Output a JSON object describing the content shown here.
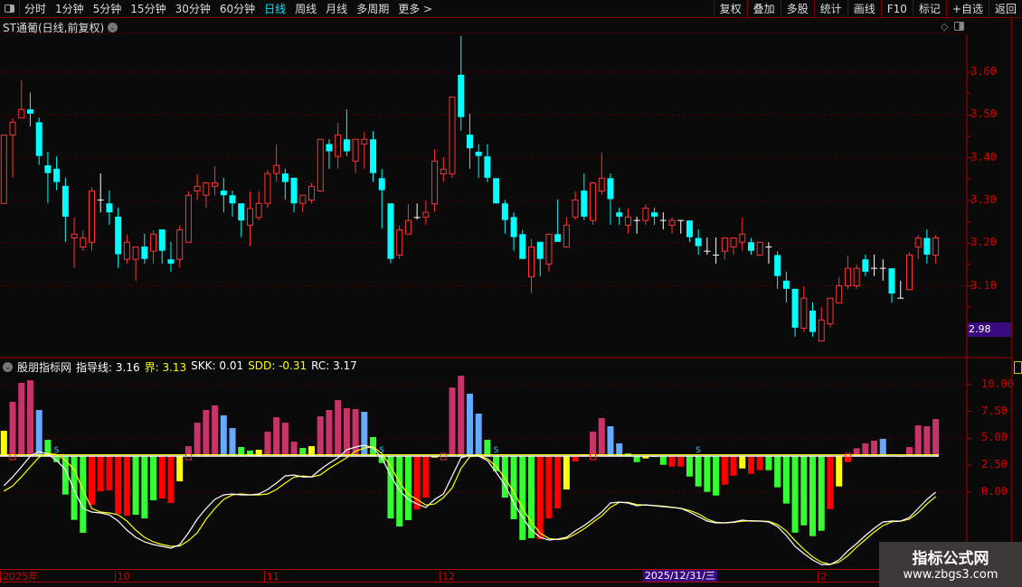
{
  "topbar": {
    "periods": [
      {
        "label": "分时"
      },
      {
        "label": "1分钟"
      },
      {
        "label": "5分钟"
      },
      {
        "label": "15分钟"
      },
      {
        "label": "30分钟"
      },
      {
        "label": "60分钟"
      },
      {
        "label": "日线",
        "active": true
      },
      {
        "label": "周线"
      },
      {
        "label": "月线"
      },
      {
        "label": "多周期"
      },
      {
        "label": "更多 >"
      }
    ],
    "buttons": [
      "复权",
      "叠加",
      "多股",
      "统计",
      "画线",
      "F10",
      "标记",
      "+自选",
      "返回"
    ]
  },
  "stock": {
    "title": "ST通葡(日线,前复权)"
  },
  "price_axis": {
    "ticks": [
      "3.60",
      "3.50",
      "3.40",
      "3.30",
      "3.20",
      "3.10"
    ],
    "tick_values": [
      3.6,
      3.5,
      3.4,
      3.3,
      3.2,
      3.1
    ],
    "current_label": "2.98",
    "current_value": 2.98
  },
  "indicator": {
    "name": "股朋指标网",
    "items": [
      {
        "label": "指导线: 3.16",
        "color": "#ffffff"
      },
      {
        "label": "界: 3.13",
        "color": "#ffff00"
      },
      {
        "label": "SKK: 0.01",
        "color": "#ffffff"
      },
      {
        "label": "SDD: -0.31",
        "color": "#ffff00"
      },
      {
        "label": "RC: 3.17",
        "color": "#ffffff"
      }
    ],
    "ticks": [
      "10.00",
      "7.50",
      "5.00",
      "2.50",
      "0.00"
    ],
    "tick_values": [
      10,
      7.5,
      5,
      2.5,
      0
    ]
  },
  "date_axis": {
    "labels": [
      {
        "text": "2025年",
        "i": 0
      },
      {
        "text": "10",
        "i": 13
      },
      {
        "text": "11",
        "i": 30
      },
      {
        "text": "12",
        "i": 50
      },
      {
        "text": "2",
        "i": 93
      }
    ],
    "cursor": {
      "text": "2025/12/31/三",
      "i": 73
    }
  },
  "watermark": {
    "line1": "指标公式网",
    "line2": "www.zbgs3.com"
  },
  "colors": {
    "up": "#ff3333",
    "down": "#00ffff",
    "doji": "#ffffff",
    "pink": "#c8336a",
    "blue": "#66aaff",
    "green": "#33ff33",
    "red": "#ff0000",
    "yellow": "#ffff00",
    "grid": "#7a0000"
  },
  "chart_data": {
    "type": "candlestick",
    "ohlc": [
      [
        3.293,
        3.453,
        3.293,
        3.453
      ],
      [
        3.453,
        3.492,
        3.353,
        3.483
      ],
      [
        3.493,
        3.581,
        3.493,
        3.513
      ],
      [
        3.513,
        3.553,
        3.473,
        3.503
      ],
      [
        3.483,
        3.494,
        3.383,
        3.404
      ],
      [
        3.382,
        3.414,
        3.293,
        3.364
      ],
      [
        3.374,
        3.403,
        3.324,
        3.343
      ],
      [
        3.334,
        3.353,
        3.203,
        3.262
      ],
      [
        3.212,
        3.26,
        3.142,
        3.221
      ],
      [
        3.191,
        3.23,
        3.182,
        3.212
      ],
      [
        3.202,
        3.331,
        3.182,
        3.322
      ],
      [
        3.301,
        3.363,
        3.272,
        3.301
      ],
      [
        3.293,
        3.323,
        3.243,
        3.272
      ],
      [
        3.262,
        3.283,
        3.142,
        3.174
      ],
      [
        3.162,
        3.219,
        3.152,
        3.202
      ],
      [
        3.162,
        3.191,
        3.112,
        3.191
      ],
      [
        3.192,
        3.222,
        3.152,
        3.163
      ],
      [
        3.181,
        3.23,
        3.152,
        3.221
      ],
      [
        3.232,
        3.232,
        3.152,
        3.182
      ],
      [
        3.162,
        3.203,
        3.133,
        3.152
      ],
      [
        3.162,
        3.241,
        3.142,
        3.231
      ],
      [
        3.202,
        3.321,
        3.202,
        3.312
      ],
      [
        3.322,
        3.361,
        3.302,
        3.333
      ],
      [
        3.312,
        3.341,
        3.283,
        3.341
      ],
      [
        3.333,
        3.38,
        3.312,
        3.341
      ],
      [
        3.323,
        3.353,
        3.272,
        3.312
      ],
      [
        3.312,
        3.323,
        3.262,
        3.293
      ],
      [
        3.293,
        3.293,
        3.214,
        3.253
      ],
      [
        3.242,
        3.321,
        3.193,
        3.281
      ],
      [
        3.26,
        3.321,
        3.253,
        3.293
      ],
      [
        3.293,
        3.372,
        3.283,
        3.363
      ],
      [
        3.363,
        3.431,
        3.343,
        3.382
      ],
      [
        3.363,
        3.374,
        3.302,
        3.343
      ],
      [
        3.353,
        3.353,
        3.272,
        3.293
      ],
      [
        3.293,
        3.312,
        3.272,
        3.312
      ],
      [
        3.301,
        3.34,
        3.293,
        3.333
      ],
      [
        3.322,
        3.443,
        3.322,
        3.443
      ],
      [
        3.432,
        3.443,
        3.374,
        3.415
      ],
      [
        3.403,
        3.482,
        3.374,
        3.453
      ],
      [
        3.443,
        3.513,
        3.404,
        3.415
      ],
      [
        3.392,
        3.443,
        3.364,
        3.443
      ],
      [
        3.432,
        3.46,
        3.374,
        3.443
      ],
      [
        3.443,
        3.462,
        3.343,
        3.364
      ],
      [
        3.352,
        3.373,
        3.234,
        3.324
      ],
      [
        3.293,
        3.293,
        3.153,
        3.163
      ],
      [
        3.172,
        3.241,
        3.163,
        3.231
      ],
      [
        3.221,
        3.291,
        3.221,
        3.253
      ],
      [
        3.26,
        3.293,
        3.255,
        3.26
      ],
      [
        3.261,
        3.3,
        3.243,
        3.272
      ],
      [
        3.292,
        3.42,
        3.273,
        3.392
      ],
      [
        3.362,
        3.401,
        3.343,
        3.373
      ],
      [
        3.362,
        3.542,
        3.353,
        3.542
      ],
      [
        3.594,
        3.685,
        3.463,
        3.495
      ],
      [
        3.454,
        3.503,
        3.374,
        3.422
      ],
      [
        3.414,
        3.432,
        3.353,
        3.404
      ],
      [
        3.403,
        3.432,
        3.343,
        3.353
      ],
      [
        3.352,
        3.352,
        3.293,
        3.293
      ],
      [
        3.293,
        3.301,
        3.222,
        3.254
      ],
      [
        3.261,
        3.272,
        3.182,
        3.214
      ],
      [
        3.221,
        3.231,
        3.163,
        3.163
      ],
      [
        3.121,
        3.21,
        3.083,
        3.191
      ],
      [
        3.203,
        3.203,
        3.122,
        3.163
      ],
      [
        3.151,
        3.221,
        3.133,
        3.221
      ],
      [
        3.221,
        3.302,
        3.203,
        3.203
      ],
      [
        3.191,
        3.26,
        3.191,
        3.242
      ],
      [
        3.261,
        3.321,
        3.254,
        3.301
      ],
      [
        3.323,
        3.363,
        3.254,
        3.262
      ],
      [
        3.253,
        3.341,
        3.243,
        3.341
      ],
      [
        3.322,
        3.412,
        3.313,
        3.352
      ],
      [
        3.352,
        3.363,
        3.243,
        3.303
      ],
      [
        3.272,
        3.283,
        3.243,
        3.262
      ],
      [
        3.242,
        3.281,
        3.222,
        3.261
      ],
      [
        3.253,
        3.262,
        3.222,
        3.253
      ],
      [
        3.253,
        3.291,
        3.243,
        3.282
      ],
      [
        3.272,
        3.283,
        3.243,
        3.262
      ],
      [
        3.253,
        3.272,
        3.232,
        3.253
      ],
      [
        3.242,
        3.26,
        3.222,
        3.253
      ],
      [
        3.253,
        3.253,
        3.222,
        3.253
      ],
      [
        3.253,
        3.253,
        3.203,
        3.214
      ],
      [
        3.212,
        3.232,
        3.173,
        3.193
      ],
      [
        3.181,
        3.213,
        3.173,
        3.181
      ],
      [
        3.172,
        3.213,
        3.152,
        3.172
      ],
      [
        3.181,
        3.212,
        3.162,
        3.212
      ],
      [
        3.191,
        3.212,
        3.173,
        3.212
      ],
      [
        3.202,
        3.26,
        3.182,
        3.221
      ],
      [
        3.202,
        3.212,
        3.173,
        3.182
      ],
      [
        3.172,
        3.202,
        3.172,
        3.202
      ],
      [
        3.191,
        3.202,
        3.152,
        3.191
      ],
      [
        3.172,
        3.181,
        3.093,
        3.123
      ],
      [
        3.112,
        3.133,
        3.061,
        3.093
      ],
      [
        3.093,
        3.093,
        2.981,
        3.002
      ],
      [
        3.001,
        3.099,
        2.992,
        3.071
      ],
      [
        3.042,
        3.061,
        2.981,
        2.992
      ],
      [
        2.971,
        3.05,
        2.971,
        3.02
      ],
      [
        3.011,
        3.071,
        3.002,
        3.071
      ],
      [
        3.06,
        3.12,
        3.06,
        3.1
      ],
      [
        3.1,
        3.171,
        3.093,
        3.141
      ],
      [
        3.1,
        3.15,
        3.093,
        3.141
      ],
      [
        3.162,
        3.173,
        3.123,
        3.133
      ],
      [
        3.141,
        3.173,
        3.123,
        3.141
      ],
      [
        3.141,
        3.162,
        3.112,
        3.141
      ],
      [
        3.141,
        3.141,
        3.061,
        3.082
      ],
      [
        3.071,
        3.112,
        3.071,
        3.071
      ],
      [
        3.091,
        3.179,
        3.091,
        3.172
      ],
      [
        3.191,
        3.219,
        3.162,
        3.212
      ],
      [
        3.212,
        3.232,
        3.152,
        3.173
      ],
      [
        3.172,
        3.219,
        3.152,
        3.212
      ]
    ],
    "ylim": [
      2.96,
      3.7
    ],
    "indicator": {
      "bar_base": 3.35,
      "bars": [
        [
          5.7,
          "yellow"
        ],
        [
          8.38,
          "pink"
        ],
        [
          10.14,
          "pink"
        ],
        [
          10.39,
          "pink"
        ],
        [
          7.63,
          "blue"
        ],
        [
          4.86,
          "green"
        ],
        [
          2.79,
          "green"
        ],
        [
          -0.22,
          "green"
        ],
        [
          -2.57,
          "green"
        ],
        [
          -3.77,
          "green"
        ],
        [
          -1.17,
          "red"
        ],
        [
          0.08,
          "red"
        ],
        [
          0.17,
          "red"
        ],
        [
          -2.01,
          "red"
        ],
        [
          -2.18,
          "red"
        ],
        [
          -2.1,
          "green"
        ],
        [
          -2.43,
          "green"
        ],
        [
          -0.75,
          "green"
        ],
        [
          -0.59,
          "red"
        ],
        [
          -1.01,
          "red"
        ],
        [
          1.01,
          "yellow"
        ],
        [
          4.27,
          "pink"
        ],
        [
          6.45,
          "pink"
        ],
        [
          7.63,
          "pink"
        ],
        [
          8.05,
          "pink"
        ],
        [
          7.13,
          "blue"
        ],
        [
          5.95,
          "blue"
        ],
        [
          4.19,
          "green"
        ],
        [
          3.86,
          "green"
        ],
        [
          3.94,
          "yellow"
        ],
        [
          5.62,
          "pink"
        ],
        [
          6.96,
          "pink"
        ],
        [
          6.45,
          "pink"
        ],
        [
          4.69,
          "pink"
        ],
        [
          4.11,
          "green"
        ],
        [
          4.27,
          "yellow"
        ],
        [
          7.04,
          "pink"
        ],
        [
          7.63,
          "pink"
        ],
        [
          8.55,
          "pink"
        ],
        [
          7.8,
          "pink"
        ],
        [
          7.71,
          "pink"
        ],
        [
          7.46,
          "blue"
        ],
        [
          5.11,
          "green"
        ],
        [
          2.71,
          "green"
        ],
        [
          -2.43,
          "green"
        ],
        [
          -3.18,
          "green"
        ],
        [
          -2.6,
          "green"
        ],
        [
          -1.59,
          "red"
        ],
        [
          -0.5,
          "red"
        ],
        [
          3.21,
          "yellow"
        ],
        [
          3.35,
          "red"
        ],
        [
          9.72,
          "pink"
        ],
        [
          10.81,
          "pink"
        ],
        [
          9.14,
          "blue"
        ],
        [
          7.29,
          "blue"
        ],
        [
          4.86,
          "green"
        ],
        [
          1.95,
          "green"
        ],
        [
          -0.5,
          "green"
        ],
        [
          -2.51,
          "green"
        ],
        [
          -4.44,
          "green"
        ],
        [
          -4.27,
          "green"
        ],
        [
          -4.36,
          "red"
        ],
        [
          -2.43,
          "red"
        ],
        [
          -1.51,
          "red"
        ],
        [
          0.25,
          "yellow"
        ],
        [
          2.85,
          "red"
        ],
        [
          3.5,
          "pink"
        ],
        [
          5.62,
          "pink"
        ],
        [
          6.87,
          "pink"
        ],
        [
          6.12,
          "blue"
        ],
        [
          4.53,
          "blue"
        ],
        [
          3.6,
          "green"
        ],
        [
          2.79,
          "green"
        ],
        [
          3.13,
          "yellow"
        ],
        [
          3.35,
          "green"
        ],
        [
          2.54,
          "green"
        ],
        [
          2.37,
          "red"
        ],
        [
          2.37,
          "red"
        ],
        [
          1.45,
          "green"
        ],
        [
          0.53,
          "green"
        ],
        [
          0.03,
          "green"
        ],
        [
          -0.31,
          "green"
        ],
        [
          0.7,
          "red"
        ],
        [
          1.53,
          "red"
        ],
        [
          2.2,
          "yellow"
        ],
        [
          1.7,
          "red"
        ],
        [
          2.04,
          "red"
        ],
        [
          2.04,
          "green"
        ],
        [
          0.45,
          "green"
        ],
        [
          -1.06,
          "green"
        ],
        [
          -3.75,
          "green"
        ],
        [
          -3.08,
          "green"
        ],
        [
          -4.08,
          "green"
        ],
        [
          -3.58,
          "green"
        ],
        [
          -1.57,
          "red"
        ],
        [
          0.53,
          "yellow"
        ],
        [
          2.79,
          "red"
        ],
        [
          4.08,
          "pink"
        ],
        [
          4.53,
          "pink"
        ],
        [
          4.78,
          "pink"
        ],
        [
          4.95,
          "blue"
        ],
        [
          3.4,
          "blue"
        ],
        [
          3.35,
          "pink"
        ],
        [
          4.19,
          "pink"
        ],
        [
          6.2,
          "pink"
        ],
        [
          6.12,
          "pink"
        ],
        [
          6.79,
          "pink"
        ]
      ],
      "white_line": [
        0.59,
        1.42,
        2.35,
        3.35,
        3.77,
        3.52,
        2.93,
        2.1,
        0.17,
        -1.51,
        -1.84,
        -1.93,
        -2.1,
        -2.68,
        -3.52,
        -4.19,
        -4.61,
        -4.86,
        -5.03,
        -5.2,
        -4.86,
        -3.77,
        -2.51,
        -1.51,
        -0.67,
        -0.25,
        -0.17,
        -0.25,
        -0.25,
        -0.17,
        0.25,
        0.84,
        1.51,
        1.59,
        1.42,
        1.42,
        2.1,
        2.68,
        3.19,
        3.94,
        4.19,
        4.36,
        4.11,
        3.19,
        1.51,
        0.17,
        -0.67,
        -1.09,
        -1.42,
        -0.67,
        -0.17,
        1.51,
        3.19,
        3.44,
        3.35,
        2.93,
        1.84,
        0.67,
        -1.01,
        -2.35,
        -3.52,
        -4.19,
        -4.44,
        -4.36,
        -4.19,
        -3.6,
        -3.1,
        -2.51,
        -1.84,
        -1.01,
        -0.92,
        -1.01,
        -1.26,
        -1.17,
        -1.26,
        -1.34,
        -1.42,
        -1.51,
        -1.84,
        -2.26,
        -2.68,
        -2.85,
        -2.85,
        -2.77,
        -2.6,
        -2.68,
        -2.68,
        -2.77,
        -3.19,
        -4.02,
        -5.03,
        -5.7,
        -6.29,
        -6.71,
        -6.71,
        -6.29,
        -5.45,
        -4.78,
        -4.02,
        -3.35,
        -2.77,
        -2.68,
        -2.68,
        -2.35,
        -1.51,
        -0.67,
        0.0
      ],
      "yellow_line": [
        0.1,
        0.59,
        1.42,
        2.35,
        3.25,
        3.6,
        3.5,
        2.93,
        2.1,
        0.17,
        -1.51,
        -1.84,
        -1.93,
        -2.1,
        -2.68,
        -3.52,
        -4.19,
        -4.61,
        -4.86,
        -5.03,
        -5.0,
        -4.5,
        -3.77,
        -2.51,
        -1.51,
        -0.67,
        -0.25,
        -0.17,
        -0.25,
        -0.25,
        -0.17,
        0.25,
        0.84,
        1.4,
        1.5,
        1.42,
        1.6,
        2.2,
        2.7,
        3.2,
        3.8,
        4.1,
        4.2,
        3.6,
        2.4,
        0.9,
        -0.2,
        -0.67,
        -1.2,
        -1.1,
        -0.5,
        0.4,
        2.2,
        3.3,
        3.4,
        3.1,
        2.4,
        1.3,
        0.0,
        -1.5,
        -2.8,
        -3.8,
        -4.3,
        -4.4,
        -4.3,
        -3.9,
        -3.4,
        -2.8,
        -2.2,
        -1.4,
        -0.95,
        -0.95,
        -1.15,
        -1.2,
        -1.25,
        -1.3,
        -1.4,
        -1.5,
        -1.7,
        -2.0,
        -2.5,
        -2.8,
        -2.85,
        -2.8,
        -2.7,
        -2.65,
        -2.68,
        -2.72,
        -3.0,
        -3.6,
        -4.5,
        -5.3,
        -6.0,
        -6.5,
        -6.7,
        -6.5,
        -5.9,
        -5.1,
        -4.4,
        -3.7,
        -3.1,
        -2.75,
        -2.7,
        -2.5,
        -1.9,
        -1.1,
        -0.4
      ],
      "s_markers": [
        6,
        43,
        56,
        79
      ],
      "square_markers": [
        1,
        21,
        50,
        67,
        96
      ]
    }
  }
}
